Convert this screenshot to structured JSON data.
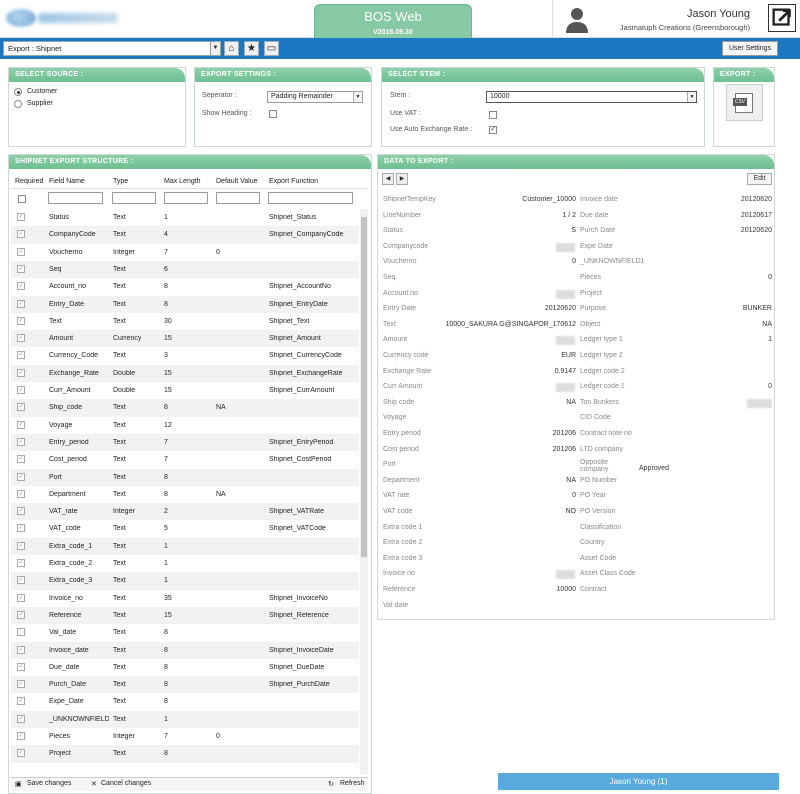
{
  "app": {
    "title": "BOS Web",
    "version": "V2016.09.30"
  },
  "user": {
    "name": "Jason Young",
    "company": "Jasmatuph Creations (Greensborough)"
  },
  "toolbar": {
    "export_selected": "Export : Shipnet",
    "user_settings": "User Settings"
  },
  "source": {
    "header": "SELECT SOURCE :",
    "options": [
      "Customer",
      "Supplier"
    ],
    "selected": "Customer"
  },
  "settings": {
    "header": "EXPORT SETTINGS :",
    "separator_label": "Seperator :",
    "separator_value": "Padding Remainder",
    "show_heading_label": "Show Heading :"
  },
  "stem": {
    "header": "SELECT STEM :",
    "stem_label": "Stem :",
    "stem_value": "10000",
    "use_vat_label": "Use VAT :",
    "use_auto_label": "Use Auto Exchange Rate :",
    "use_auto_checked": "✓"
  },
  "export": {
    "header": "EXPORT :",
    "csv_label": "CSV"
  },
  "structure": {
    "header": "SHIPNET EXPORT STRUCTURE :",
    "columns": [
      "Required",
      "Field Name",
      "Type",
      "Max Length",
      "Default Value",
      "Export Function"
    ],
    "rows": [
      [
        "Status",
        "Text",
        "1",
        "",
        "Shipnet_Status"
      ],
      [
        "CompanyCode",
        "Text",
        "4",
        "",
        "Shipnet_CompanyCode"
      ],
      [
        "Voucherno",
        "Integer",
        "7",
        "0",
        ""
      ],
      [
        "Seq",
        "Text",
        "6",
        "",
        ""
      ],
      [
        "Account_no",
        "Text",
        "8",
        "",
        "Shipnet_AccountNo"
      ],
      [
        "Entry_Date",
        "Text",
        "8",
        "",
        "Shipnet_EntryDate"
      ],
      [
        "Text",
        "Text",
        "30",
        "",
        "Shipnet_Text"
      ],
      [
        "Amount",
        "Currency",
        "15",
        "",
        "Shipnet_Amount"
      ],
      [
        "Currency_Code",
        "Text",
        "3",
        "",
        "Shipnet_CurrencyCode"
      ],
      [
        "Exchange_Rate",
        "Double",
        "15",
        "",
        "Shipnet_ExchangeRate"
      ],
      [
        "Curr_Amount",
        "Double",
        "15",
        "",
        "Shipnet_CurrAmount"
      ],
      [
        "Ship_code",
        "Text",
        "8",
        "NA",
        ""
      ],
      [
        "Voyage",
        "Text",
        "12",
        "",
        ""
      ],
      [
        "Entry_period",
        "Text",
        "7",
        "",
        "Shipnet_EntryPeriod"
      ],
      [
        "Cost_period",
        "Text",
        "7",
        "",
        "Shipnet_CostPeriod"
      ],
      [
        "Port",
        "Text",
        "8",
        "",
        ""
      ],
      [
        "Department",
        "Text",
        "8",
        "NA",
        ""
      ],
      [
        "VAT_rate",
        "Integer",
        "2",
        "",
        "Shipnet_VATRate"
      ],
      [
        "VAT_code",
        "Text",
        "5",
        "",
        "Shipnet_VATCode"
      ],
      [
        "Extra_code_1",
        "Text",
        "1",
        "",
        ""
      ],
      [
        "Extra_code_2",
        "Text",
        "1",
        "",
        ""
      ],
      [
        "Extra_code_3",
        "Text",
        "1",
        "",
        ""
      ],
      [
        "Invoice_no",
        "Text",
        "35",
        "",
        "Shipnet_InvoiceNo"
      ],
      [
        "Reference",
        "Text",
        "15",
        "",
        "Shipnet_Reference"
      ],
      [
        "Val_date",
        "Text",
        "8",
        "",
        ""
      ],
      [
        "Invoice_date",
        "Text",
        "8",
        "",
        "Shipnet_InvoiceDate"
      ],
      [
        "Due_date",
        "Text",
        "8",
        "",
        "Shipnet_DueDate"
      ],
      [
        "Purch_Date",
        "Text",
        "8",
        "",
        "Shipnet_PurchDate"
      ],
      [
        "Expe_Date",
        "Text",
        "8",
        "",
        ""
      ],
      [
        "_UNKNOWNFIELD",
        "Text",
        "1",
        "",
        ""
      ],
      [
        "Pieces",
        "Integer",
        "7",
        "0",
        ""
      ],
      [
        "Project",
        "Text",
        "8",
        "",
        ""
      ]
    ],
    "required_unchecked_index": 24,
    "save": "Save changes",
    "cancel": "Cancel changes",
    "refresh": "Refresh"
  },
  "data": {
    "header": "DATA TO EXPORT :",
    "edit": "Edit",
    "left": [
      [
        "ShipnetTempKey",
        "Customer_10000"
      ],
      [
        "LineNumber",
        "1 / 2"
      ],
      [
        "Status",
        "S"
      ],
      [
        "Companycode",
        ""
      ],
      [
        "Voucherno",
        "0"
      ],
      [
        "Seq",
        ""
      ],
      [
        "Account no",
        ""
      ],
      [
        "Entry Date",
        "20120620"
      ],
      [
        "Text",
        "10000_SAKURA G@SINGAPOR_170612"
      ],
      [
        "Amount",
        ""
      ],
      [
        "Currency code",
        "EUR"
      ],
      [
        "Exchange Rate",
        "0.9147"
      ],
      [
        "Curr Amount",
        ""
      ],
      [
        "Ship code",
        "NA"
      ],
      [
        "Voyage",
        ""
      ],
      [
        "Entry period",
        "201206"
      ],
      [
        "Cost period",
        "201206"
      ],
      [
        "Port",
        ""
      ],
      [
        "Department",
        "NA"
      ],
      [
        "VAT rate",
        "0"
      ],
      [
        "VAT code",
        "NO"
      ],
      [
        "Extra code 1",
        ""
      ],
      [
        "Extra code 2",
        ""
      ],
      [
        "Extra code 3",
        ""
      ],
      [
        "Invoice no",
        ""
      ],
      [
        "Reference",
        "10000"
      ],
      [
        "Val date",
        ""
      ]
    ],
    "right": [
      [
        "Invoice date",
        "20120620"
      ],
      [
        "Due date",
        "20120617"
      ],
      [
        "Purch Date",
        "20120620"
      ],
      [
        "Expe Date",
        ""
      ],
      [
        "_UNKNOWNFIELD1",
        ""
      ],
      [
        "Pieces",
        "0"
      ],
      [
        "Project",
        ""
      ],
      [
        "Purpose",
        "BUNKER"
      ],
      [
        "Object",
        "NA"
      ],
      [
        "Ledger type 1",
        "1"
      ],
      [
        "Ledger type 2",
        ""
      ],
      [
        "Ledger code 2",
        ""
      ],
      [
        "Ledger code 1",
        "0"
      ],
      [
        "Ton Bunkers",
        ""
      ],
      [
        "CID Code",
        ""
      ],
      [
        "Contract note no",
        ""
      ],
      [
        "LTD company",
        ""
      ],
      [
        "Opposite company",
        "Approved"
      ],
      [
        "PO Number",
        ""
      ],
      [
        "PO Year",
        ""
      ],
      [
        "PO Version",
        ""
      ],
      [
        "Classification",
        ""
      ],
      [
        "Country",
        ""
      ],
      [
        "Asset Code",
        ""
      ],
      [
        "Asset Class Code",
        ""
      ],
      [
        "Contract",
        ""
      ]
    ]
  },
  "statusbar": {
    "label": "Jason Young (1)"
  }
}
